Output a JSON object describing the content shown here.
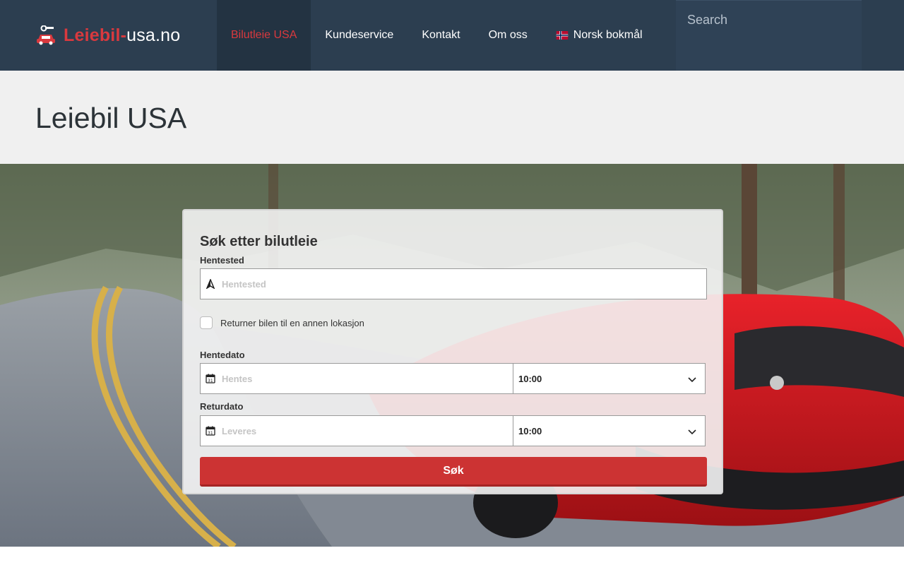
{
  "header": {
    "logo": {
      "part1": "Leiebil-",
      "part2": "usa.no"
    },
    "nav": [
      {
        "label": "Bilutleie USA",
        "active": true
      },
      {
        "label": "Kundeservice"
      },
      {
        "label": "Kontakt"
      },
      {
        "label": "Om oss"
      },
      {
        "label": "Norsk bokmål",
        "icon": "norway-flag-icon"
      }
    ],
    "search": {
      "placeholder": "Search",
      "value": ""
    }
  },
  "page": {
    "title": "Leiebil USA"
  },
  "form": {
    "title": "Søk etter bilutleie",
    "pickup_location": {
      "label": "Hentested",
      "placeholder": "Hentested",
      "icon": "location-arrow-icon"
    },
    "return_other": {
      "label": "Returner bilen til en annen lokasjon",
      "checked": false
    },
    "pickup_date": {
      "label": "Hentedato",
      "placeholder": "Hentes",
      "time": "10:00",
      "icon": "calendar-icon"
    },
    "return_date": {
      "label": "Returdato",
      "placeholder": "Leveres",
      "time": "10:00",
      "icon": "calendar-icon"
    },
    "submit_label": "Søk"
  },
  "colors": {
    "header_bg": "#2c3e50",
    "accent": "#d9393e",
    "button": "#cc3333"
  }
}
